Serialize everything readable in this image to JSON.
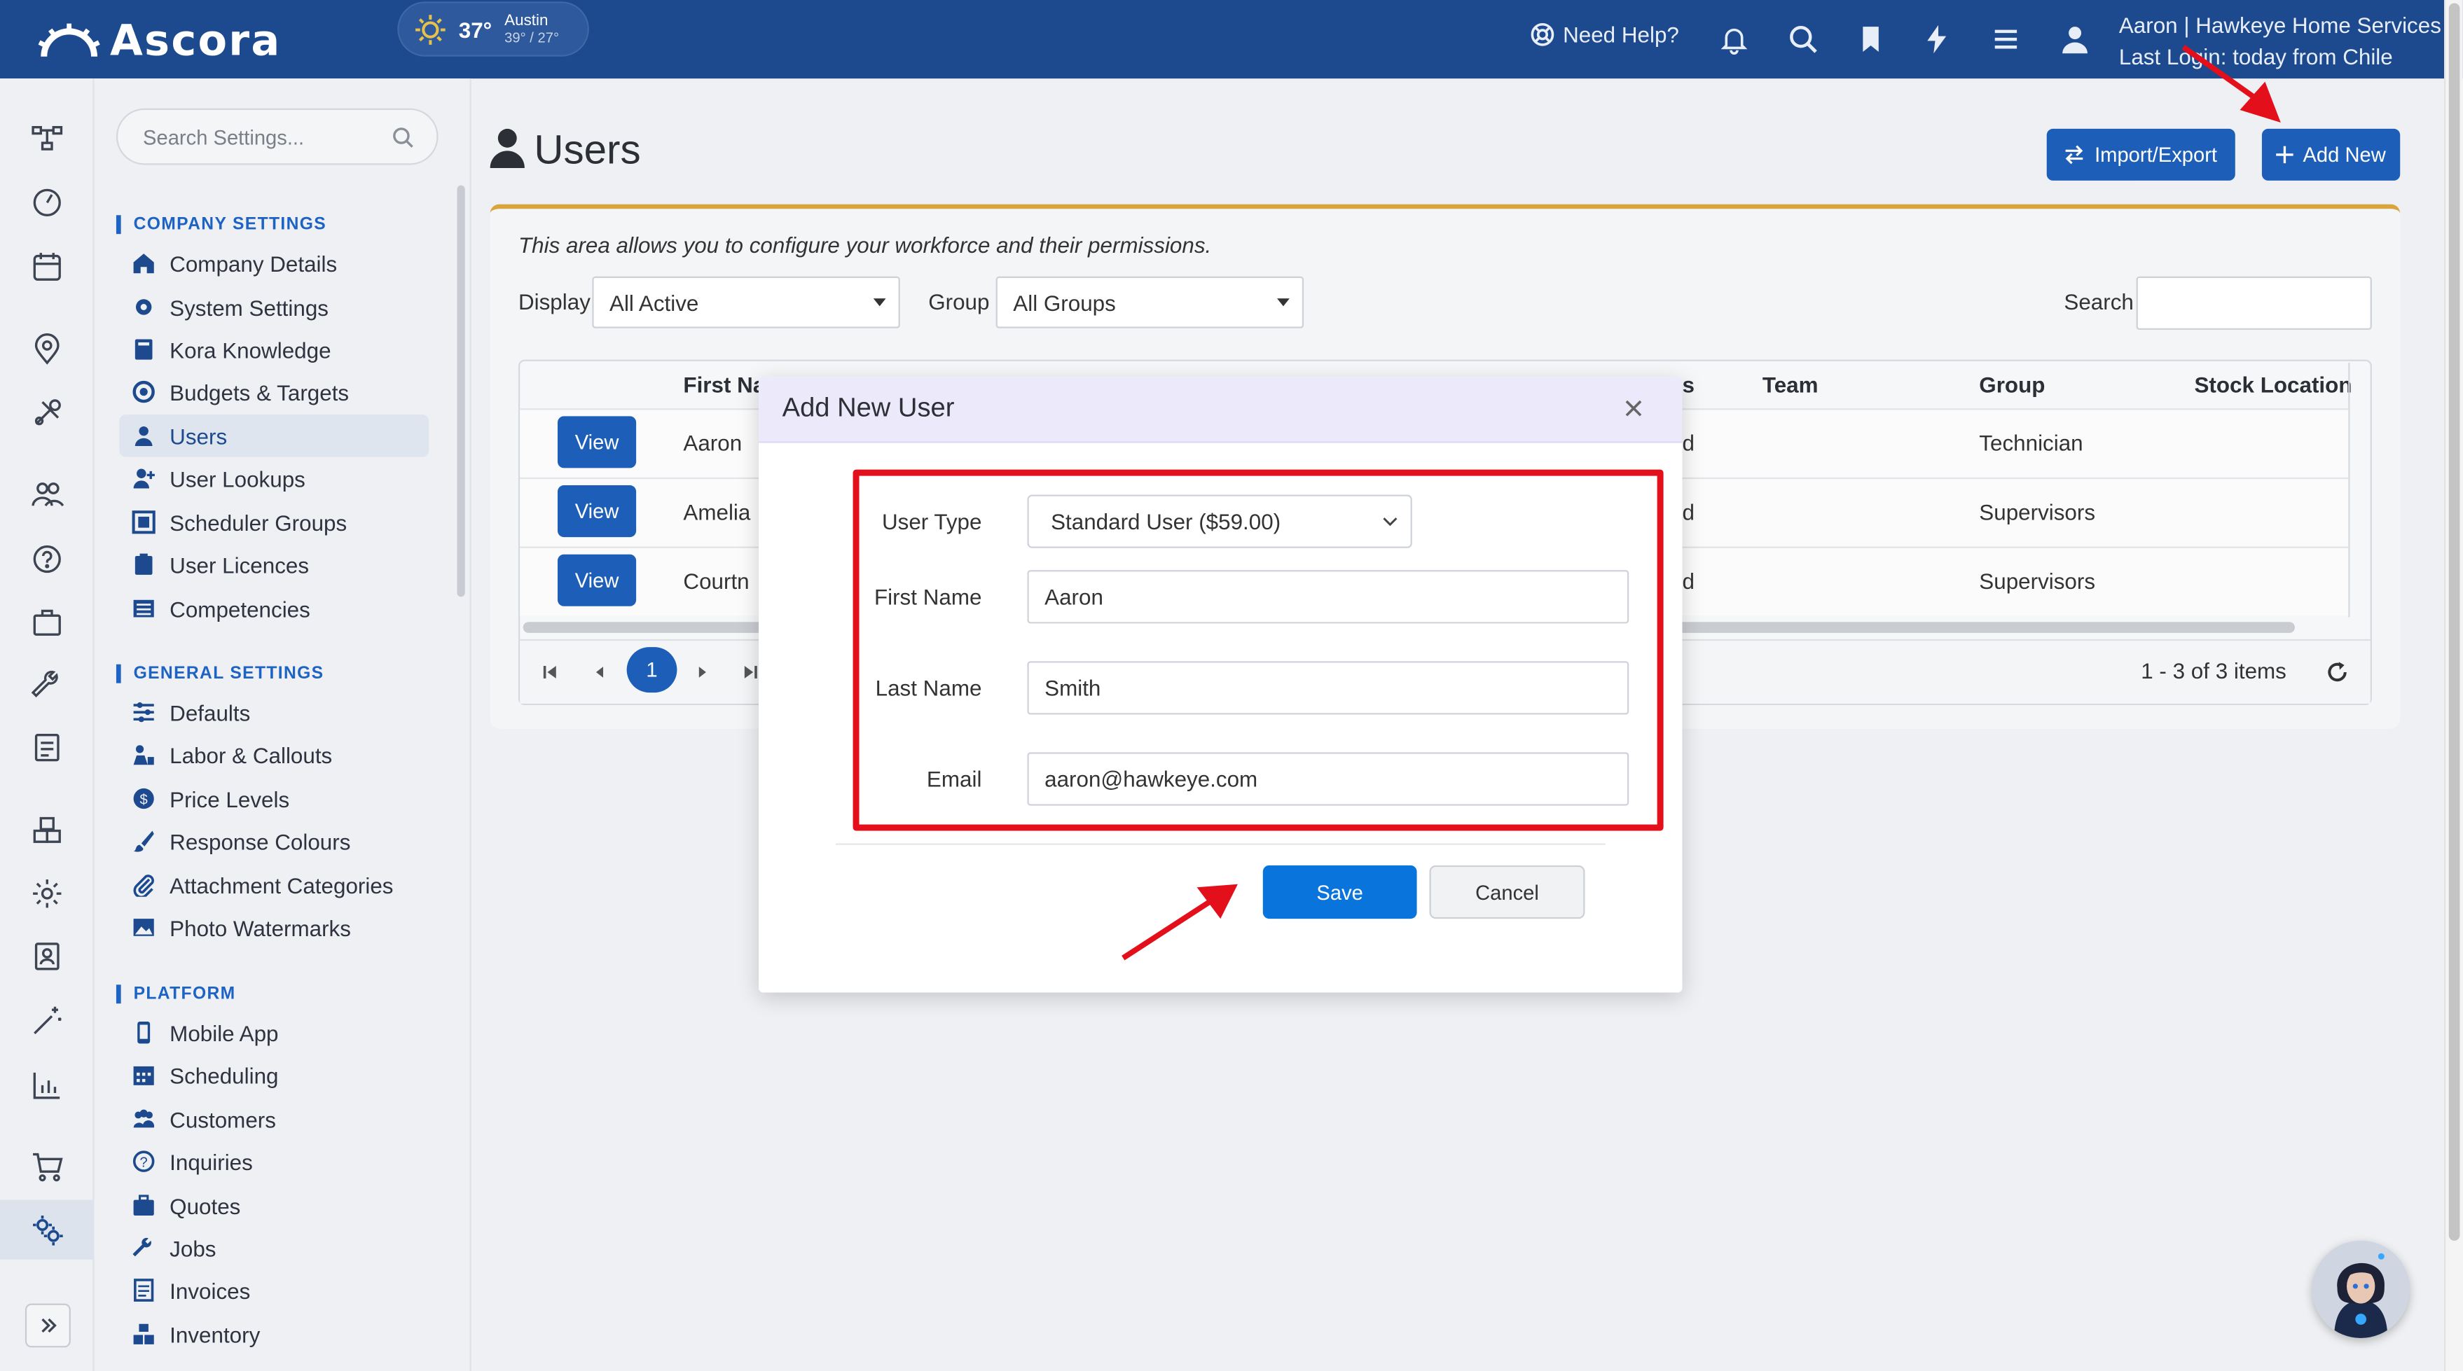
{
  "app": {
    "logo_text": "Ascora"
  },
  "weather": {
    "temp": "37°",
    "city": "Austin",
    "range": "39° / 27°"
  },
  "topbar": {
    "need_help": "Need Help?",
    "user_line1": "Aaron | Hawkeye Home Services",
    "user_line2": "Last Login: today from Chile"
  },
  "sidebar": {
    "search_placeholder": "Search Settings...",
    "sections": {
      "company": "COMPANY SETTINGS",
      "general": "GENERAL SETTINGS",
      "platform": "PLATFORM"
    },
    "company_items": [
      "Company Details",
      "System Settings",
      "Kora Knowledge",
      "Budgets & Targets",
      "Users",
      "User Lookups",
      "Scheduler Groups",
      "User Licences",
      "Competencies"
    ],
    "general_items": [
      "Defaults",
      "Labor & Callouts",
      "Price Levels",
      "Response Colours",
      "Attachment Categories",
      "Photo Watermarks"
    ],
    "platform_items": [
      "Mobile App",
      "Scheduling",
      "Customers",
      "Inquiries",
      "Quotes",
      "Jobs",
      "Invoices",
      "Inventory"
    ],
    "active_item": "Users"
  },
  "page": {
    "title": "Users",
    "import_export": "Import/Export",
    "add_new": "Add New",
    "description": "This area allows you to configure your workforce and their permissions.",
    "display_label": "Display",
    "display_value": "All Active",
    "group_label": "Group",
    "group_value": "All Groups",
    "search_label": "Search"
  },
  "table": {
    "columns": [
      "First Na",
      "s",
      "Team",
      "Group",
      "Stock Location"
    ],
    "view_label": "View",
    "rows": [
      {
        "first": "Aaron",
        "status_frag": "d",
        "group": "Technician"
      },
      {
        "first": "Amelia",
        "status_frag": "d",
        "group": "Supervisors"
      },
      {
        "first": "Courtn",
        "status_frag": "d",
        "group": "Supervisors"
      }
    ],
    "current_page": "1",
    "items_count": "1 - 3 of 3 items"
  },
  "modal": {
    "title": "Add New User",
    "user_type_label": "User Type",
    "user_type_value": "Standard User ($59.00)",
    "first_name_label": "First Name",
    "first_name_value": "Aaron",
    "last_name_label": "Last Name",
    "last_name_value": "Smith",
    "email_label": "Email",
    "email_value": "aaron@hawkeye.com",
    "save": "Save",
    "cancel": "Cancel"
  },
  "colors": {
    "topbar": "#1d4a8e",
    "primary_button": "#1d5fb8",
    "save_button": "#0a74dd",
    "highlight": "#e3101b",
    "annotation_arrow": "#e3101b"
  }
}
